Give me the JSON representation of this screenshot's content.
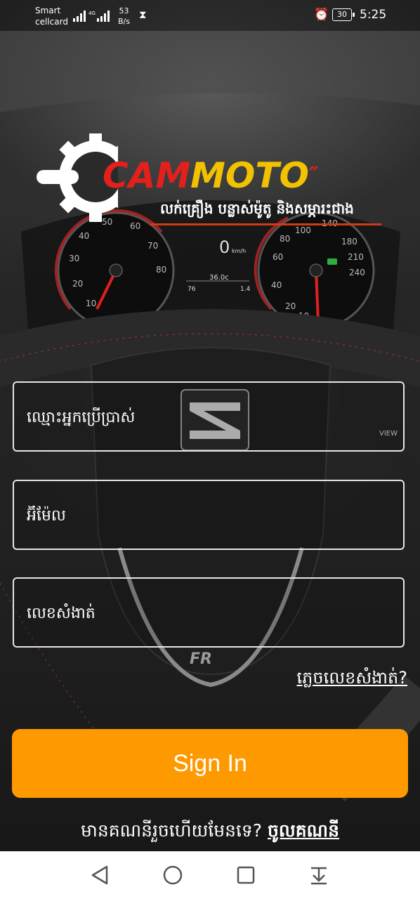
{
  "status_bar": {
    "carrier_line1": "Smart",
    "carrier_line2": "cellcard",
    "network": "4G",
    "speed_value": "53",
    "speed_unit": "B/s",
    "battery": "30",
    "time": "5:25"
  },
  "logo": {
    "brand_part1": "CAM",
    "brand_part2": "MOTO",
    "tagline": "លក់គ្រឿង បន្លាស់ម៉ូតូ និងសម្ភារះជាង",
    "colors": {
      "cam": "#e3201b",
      "moto": "#f2c200",
      "underline": "#d23a16"
    }
  },
  "form": {
    "username_placeholder": "ឈ្មោះអ្នកប្រើប្រាស់",
    "email_placeholder": "អ៊ីម៉ែល",
    "password_placeholder": "លេខសំងាត់",
    "forgot_password": "ភ្លេចលេខសំងាត់?",
    "signin_label": "Sign In",
    "signin_color": "#ff9900",
    "have_account_text": "មានគណនីរួចហើយមែនទេ? ",
    "login_link": "ចូលគណនី"
  },
  "background": {
    "speedo_left_ticks": [
      "10",
      "20",
      "30",
      "40",
      "50",
      "60",
      "70",
      "80"
    ],
    "speedo_right_ticks": [
      "10",
      "20",
      "40",
      "60",
      "80",
      "100",
      "140",
      "180",
      "210",
      "240"
    ],
    "digital_speed": "0",
    "digital_unit": "km/h",
    "temp": "36.0c",
    "trip_a": "76",
    "trip_b": "1.4",
    "view_label": "VIEW"
  },
  "navbar": {
    "icons": [
      "back-triangle-icon",
      "home-circle-icon",
      "recents-square-icon",
      "notification-pull-icon"
    ]
  }
}
